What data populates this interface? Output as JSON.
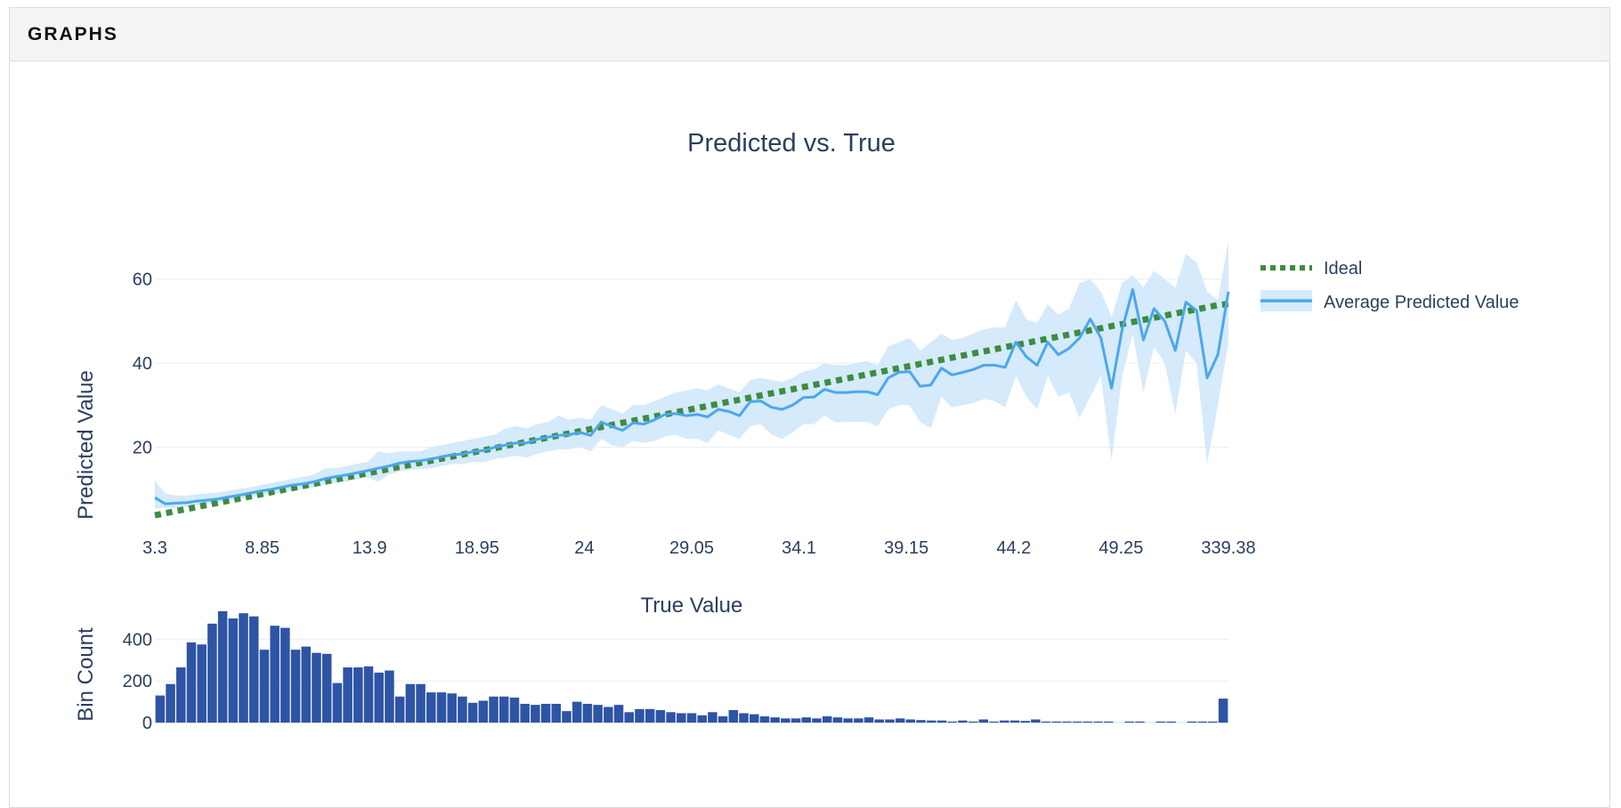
{
  "panel": {
    "title": "GRAPHS"
  },
  "colors": {
    "ideal": "#3d8c40",
    "average": "#4aa8ec",
    "band": "#d5eafb",
    "bins": "#2e54a6",
    "text": "#2a3f5f"
  },
  "chart_data": [
    {
      "type": "line",
      "title": "Predicted vs. True",
      "xlabel": "True Value",
      "ylabel": "Predicted Value",
      "x_tick_labels": [
        "3.3",
        "8.85",
        "13.9",
        "18.95",
        "24",
        "29.05",
        "34.1",
        "39.15",
        "44.2",
        "49.25",
        "339.38"
      ],
      "y_ticks": [
        20,
        40,
        60
      ],
      "ylim": [
        0,
        65
      ],
      "grid": true,
      "legend": "top-right",
      "x": [
        3.3,
        3.8,
        4.3,
        4.8,
        5.3,
        5.8,
        6.3,
        6.8,
        7.3,
        7.8,
        8.3,
        8.8,
        9.3,
        9.8,
        10.3,
        10.8,
        11.3,
        11.8,
        12.3,
        12.8,
        13.3,
        13.8,
        14.3,
        14.8,
        15.3,
        15.8,
        16.3,
        16.8,
        17.3,
        17.8,
        18.3,
        18.8,
        19.3,
        19.8,
        20.3,
        20.8,
        21.3,
        21.8,
        22.3,
        22.8,
        23.3,
        23.8,
        24.3,
        24.8,
        25.3,
        25.8,
        26.3,
        26.8,
        27.3,
        27.8,
        28.3,
        28.8,
        29.3,
        29.8,
        30.3,
        30.8,
        31.3,
        31.8,
        32.3,
        32.8,
        33.3,
        33.8,
        34.3,
        34.8,
        35.3,
        35.8,
        36.3,
        36.8,
        37.3,
        37.8,
        38.3,
        38.8,
        39.3,
        39.8,
        40.3,
        40.8,
        41.3,
        41.8,
        42.3,
        42.8,
        43.3,
        43.8,
        44.3,
        44.8,
        45.3,
        45.8,
        46.3,
        46.8,
        47.3,
        47.8,
        48.3,
        48.8,
        49.3,
        49.8,
        50.3,
        50.8,
        51.3,
        51.8,
        52.3,
        52.8,
        53.3,
        339.38
      ],
      "series": [
        {
          "name": "Ideal",
          "style": "dotted",
          "y": [
            3.8,
            4.3,
            4.8,
            5.3,
            5.8,
            6.3,
            6.8,
            7.3,
            7.8,
            8.3,
            8.8,
            9.3,
            9.8,
            10.3,
            10.8,
            11.3,
            11.8,
            12.3,
            12.8,
            13.3,
            13.8,
            14.3,
            14.8,
            15.3,
            15.8,
            16.3,
            16.8,
            17.3,
            17.8,
            18.3,
            18.8,
            19.3,
            19.8,
            20.3,
            20.8,
            21.3,
            21.8,
            22.3,
            22.8,
            23.3,
            23.8,
            24.3,
            24.8,
            25.3,
            25.8,
            26.3,
            26.8,
            27.3,
            27.8,
            28.3,
            28.8,
            29.3,
            29.8,
            30.3,
            30.8,
            31.3,
            31.8,
            32.3,
            32.8,
            33.3,
            33.8,
            34.3,
            34.8,
            35.3,
            35.8,
            36.3,
            36.8,
            37.3,
            37.8,
            38.3,
            38.8,
            39.3,
            39.8,
            40.3,
            40.8,
            41.3,
            41.8,
            42.3,
            42.8,
            43.3,
            43.8,
            44.3,
            44.8,
            45.3,
            45.8,
            46.3,
            46.8,
            47.3,
            47.8,
            48.3,
            48.8,
            49.3,
            49.8,
            50.3,
            50.8,
            51.3,
            51.8,
            52.3,
            52.8,
            53.3,
            53.8,
            54.1
          ]
        },
        {
          "name": "Average Predicted Value",
          "style": "solid",
          "y": [
            8.0,
            6.5,
            6.7,
            6.8,
            7.2,
            7.4,
            7.7,
            8.2,
            8.6,
            9.1,
            9.6,
            10.0,
            10.5,
            11.0,
            11.3,
            11.8,
            12.5,
            13.0,
            13.4,
            13.9,
            14.4,
            15.0,
            15.5,
            16.2,
            16.6,
            16.8,
            17.2,
            17.7,
            18.2,
            18.4,
            19.0,
            19.2,
            20.0,
            20.5,
            21.0,
            21.0,
            21.9,
            22.4,
            22.8,
            23.0,
            23.5,
            22.8,
            26.0,
            24.9,
            24.0,
            25.8,
            25.5,
            26.5,
            27.8,
            28.0,
            27.5,
            27.8,
            27.2,
            29.0,
            28.5,
            27.5,
            30.8,
            31.0,
            29.5,
            29.0,
            30.0,
            31.8,
            31.9,
            33.8,
            33.0,
            33.0,
            33.2,
            33.2,
            32.5,
            36.5,
            37.8,
            38.0,
            34.5,
            34.8,
            38.8,
            37.2,
            37.8,
            38.5,
            39.5,
            39.5,
            39.0,
            45.0,
            41.5,
            39.5,
            45.0,
            42.0,
            43.5,
            46.0,
            50.5,
            46.0,
            34.0,
            48.0,
            57.5,
            45.5,
            53.0,
            50.0,
            43.0,
            54.5,
            52.5,
            36.5,
            42.0,
            57.0
          ]
        }
      ],
      "band": {
        "lower": [
          5.5,
          5.5,
          5.5,
          5.8,
          6.2,
          6.5,
          6.8,
          7.2,
          7.6,
          8.0,
          8.5,
          8.9,
          9.3,
          9.8,
          10.0,
          10.5,
          11.0,
          11.5,
          11.8,
          12.3,
          12.8,
          11.8,
          13.5,
          14.2,
          14.6,
          14.8,
          15.0,
          15.5,
          16.0,
          16.0,
          16.5,
          16.5,
          17.2,
          17.5,
          18.0,
          17.5,
          18.5,
          19.0,
          19.5,
          19.5,
          20.0,
          19.0,
          22.0,
          20.5,
          20.0,
          21.5,
          21.0,
          21.5,
          22.5,
          23.0,
          22.0,
          22.0,
          21.0,
          24.0,
          23.0,
          22.0,
          25.0,
          25.5,
          23.0,
          22.0,
          23.5,
          25.5,
          25.5,
          27.5,
          26.0,
          26.0,
          26.0,
          26.0,
          25.0,
          29.0,
          30.0,
          30.0,
          26.0,
          24.5,
          32.0,
          29.5,
          30.0,
          30.5,
          31.5,
          31.0,
          29.5,
          37.0,
          32.0,
          29.0,
          37.0,
          32.0,
          33.0,
          27.0,
          32.0,
          37.0,
          17.0,
          37.0,
          47.0,
          33.0,
          44.0,
          40.0,
          28.0,
          43.0,
          40.0,
          16.0,
          30.0,
          45.0
        ],
        "upper": [
          12.0,
          9.0,
          8.5,
          8.5,
          8.8,
          9.0,
          9.2,
          9.7,
          10.1,
          10.5,
          11.0,
          11.5,
          12.0,
          12.5,
          13.0,
          13.5,
          15.0,
          15.0,
          15.5,
          16.0,
          16.5,
          19.0,
          18.5,
          19.0,
          19.0,
          19.0,
          20.0,
          20.5,
          21.0,
          21.5,
          22.0,
          22.5,
          23.0,
          24.5,
          25.0,
          24.5,
          25.5,
          26.0,
          27.5,
          26.5,
          27.0,
          26.5,
          30.0,
          29.0,
          28.0,
          30.0,
          30.0,
          31.0,
          32.0,
          33.0,
          33.5,
          34.0,
          33.5,
          35.0,
          34.0,
          33.0,
          36.0,
          36.5,
          36.0,
          35.5,
          36.5,
          38.0,
          38.5,
          40.0,
          39.5,
          39.5,
          40.0,
          40.5,
          39.5,
          44.0,
          45.0,
          46.0,
          43.0,
          45.0,
          47.0,
          45.5,
          46.0,
          47.0,
          48.0,
          48.5,
          48.5,
          55.0,
          50.5,
          49.5,
          54.0,
          51.5,
          53.0,
          59.0,
          60.0,
          57.0,
          51.0,
          59.0,
          61.0,
          58.0,
          62.0,
          60.0,
          58.0,
          66.0,
          64.0,
          57.0,
          55.0,
          69.0
        ]
      }
    },
    {
      "type": "bar",
      "ylabel": "Bin Count",
      "y_ticks": [
        0,
        200,
        400
      ],
      "ylim": [
        0,
        500
      ],
      "values": [
        130,
        185,
        265,
        385,
        375,
        475,
        535,
        500,
        525,
        510,
        350,
        465,
        455,
        350,
        365,
        335,
        330,
        190,
        265,
        265,
        270,
        240,
        250,
        125,
        185,
        185,
        145,
        145,
        140,
        125,
        95,
        105,
        125,
        125,
        120,
        90,
        85,
        90,
        90,
        55,
        100,
        90,
        85,
        75,
        85,
        50,
        65,
        65,
        60,
        50,
        45,
        45,
        35,
        50,
        30,
        60,
        45,
        40,
        30,
        25,
        20,
        20,
        25,
        20,
        30,
        25,
        20,
        20,
        25,
        15,
        15,
        20,
        15,
        12,
        10,
        10,
        5,
        10,
        5,
        15,
        5,
        10,
        10,
        8,
        15,
        5,
        5,
        5,
        5,
        5,
        5,
        5,
        0,
        5,
        5,
        0,
        5,
        5,
        0,
        5,
        5,
        5,
        115
      ]
    }
  ]
}
